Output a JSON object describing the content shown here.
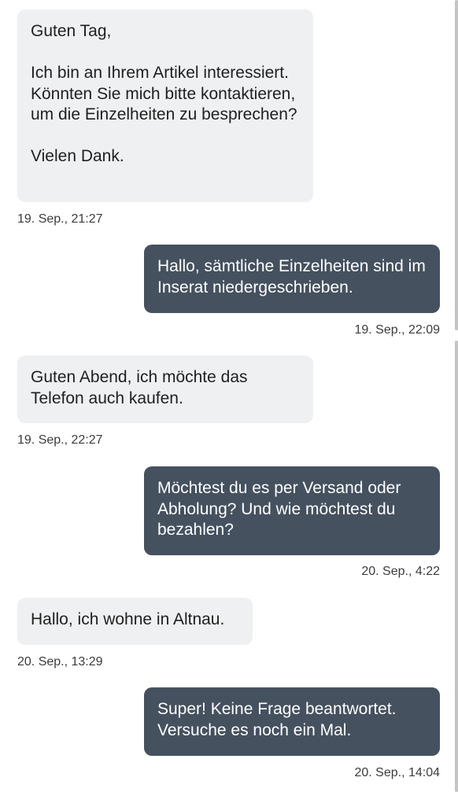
{
  "messages": [
    {
      "direction": "incoming",
      "text": "Guten Tag,\n\nIch bin an Ihrem Artikel interessiert. Könnten Sie mich bitte kontaktieren, um die Einzelheiten zu besprechen?\n\nVielen Dank.",
      "timestamp": "19. Sep., 21:27"
    },
    {
      "direction": "outgoing",
      "text": "Hallo, sämtliche Einzelheiten sind im Inserat niedergeschrieben.",
      "timestamp": "19. Sep., 22:09"
    },
    {
      "direction": "incoming",
      "text": "Guten Abend, ich möchte das Telefon auch kaufen.",
      "timestamp": "19. Sep., 22:27"
    },
    {
      "direction": "outgoing",
      "text": "Möchtest du es per Versand oder Abholung? Und wie möchtest du bezahlen?",
      "timestamp": "20. Sep., 4:22"
    },
    {
      "direction": "incoming",
      "text": "Hallo, ich wohne in Altnau.",
      "timestamp": "20. Sep., 13:29"
    },
    {
      "direction": "outgoing",
      "text": "Super! Keine Frage beantwortet. Versuche es noch ein Mal.",
      "timestamp": "20. Sep., 14:04"
    }
  ],
  "colors": {
    "incoming_bubble": "#eff0f2",
    "outgoing_bubble": "#45515f",
    "incoming_text": "#1f1f1f",
    "outgoing_text": "#ffffff",
    "timestamp_text": "#3c3c3c"
  }
}
